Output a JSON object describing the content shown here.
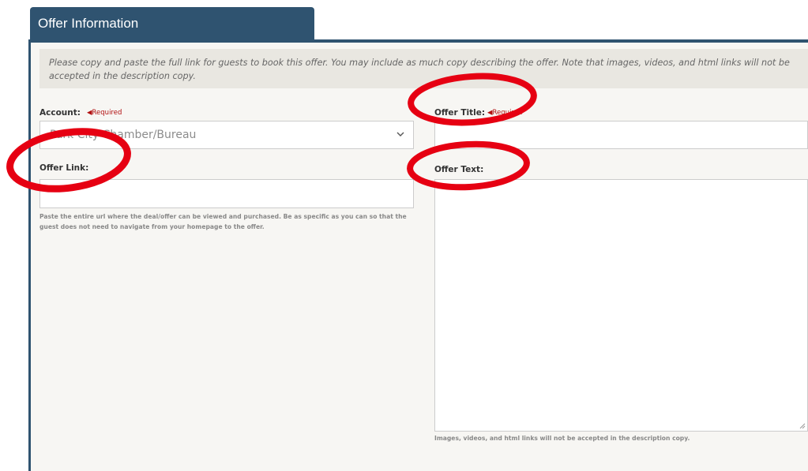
{
  "tab": {
    "title": "Offer Information"
  },
  "notice": {
    "text": "Please copy and paste the full link for guests to book this offer. You may include as much copy describing the offer. Note that images, videos, and html links will not be accepted in the description copy."
  },
  "account": {
    "label": "Account:",
    "required": "◀Required",
    "selected_value": "Park City Chamber/Bureau"
  },
  "offer_link": {
    "label": "Offer Link:",
    "value": "",
    "help": "Paste the entire url where the deal/offer can be viewed and purchased. Be as specific as you can so that the guest does not need to navigate from your homepage to the offer."
  },
  "offer_title": {
    "label": "Offer Title:",
    "required": "◀Required",
    "value": ""
  },
  "offer_text": {
    "label": "Offer Text:",
    "value": "",
    "help": "Images, videos, and html links will not be accepted in the description copy."
  },
  "colors": {
    "header": "#2f5370",
    "panel": "#f7f6f3",
    "notice": "#e9e7e1",
    "required": "#b10f0f",
    "annotation": "#e60012"
  },
  "icons": {
    "select_chevron": "chevron-down-icon",
    "resize_handle": "resize-grip-icon"
  }
}
